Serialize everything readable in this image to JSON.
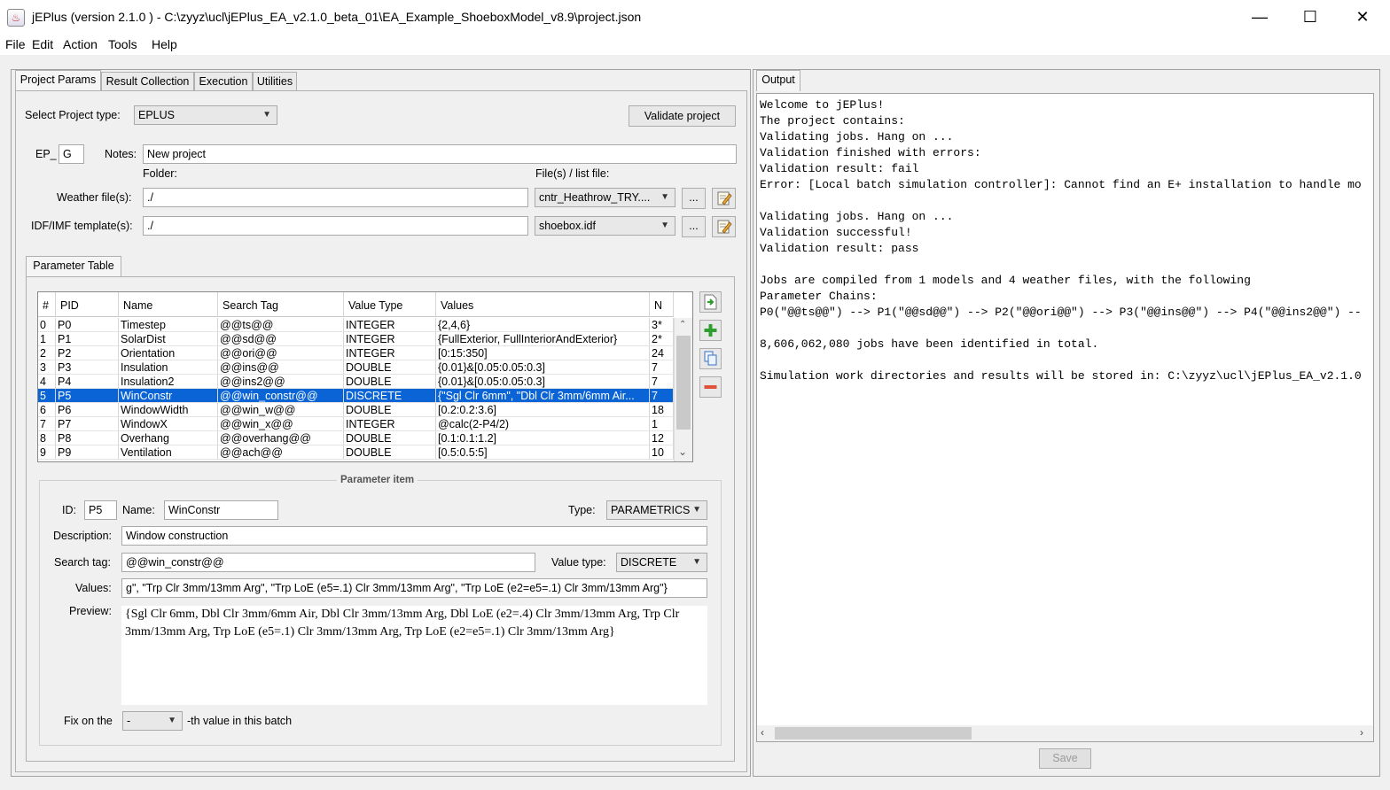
{
  "window": {
    "title": "jEPlus (version 2.1.0 )  - C:\\zyyz\\ucl\\jEPlus_EA_v2.1.0_beta_01\\EA_Example_ShoeboxModel_v8.9\\project.json",
    "minimize": "—",
    "maximize": "☐",
    "close": "✕"
  },
  "menu": [
    "File",
    "Edit",
    "Action",
    "Tools",
    "Help"
  ],
  "left_tabs": [
    "Project Params",
    "Result Collection",
    "Execution",
    "Utilities"
  ],
  "project": {
    "type_label": "Select Project type:",
    "type_value": "EPLUS",
    "validate_label": "Validate project",
    "ep_label": "EP_",
    "ep_value": "G",
    "notes_label": "Notes:",
    "notes_value": "New project",
    "folder_label": "Folder:",
    "files_label": "File(s) / list file:",
    "weather_label": "Weather file(s):",
    "weather_folder": "./",
    "weather_file": "cntr_Heathrow_TRY....",
    "idf_label": "IDF/IMF template(s):",
    "idf_folder": "./",
    "idf_file": "shoebox.idf",
    "browse": "..."
  },
  "param_table": {
    "tab_label": "Parameter Table",
    "columns": [
      "#",
      "PID",
      "Name",
      "Search Tag",
      "Value Type",
      "Values",
      "N"
    ],
    "rows": [
      [
        "0",
        "P0",
        "Timestep",
        "@@ts@@",
        "INTEGER",
        "{2,4,6}",
        "3*"
      ],
      [
        "1",
        "P1",
        "SolarDist",
        "@@sd@@",
        "INTEGER",
        "{FullExterior, FullInteriorAndExterior}",
        "2*"
      ],
      [
        "2",
        "P2",
        "Orientation",
        "@@ori@@",
        "INTEGER",
        "[0:15:350]",
        "24"
      ],
      [
        "3",
        "P3",
        "Insulation",
        "@@ins@@",
        "DOUBLE",
        "{0.01}&[0.05:0.05:0.3]",
        "7"
      ],
      [
        "4",
        "P4",
        "Insulation2",
        "@@ins2@@",
        "DOUBLE",
        "{0.01}&[0.05:0.05:0.3]",
        "7"
      ],
      [
        "5",
        "P5",
        "WinConstr",
        "@@win_constr@@",
        "DISCRETE",
        "{\"Sgl Clr 6mm\", \"Dbl Clr 3mm/6mm Air...",
        "7"
      ],
      [
        "6",
        "P6",
        "WindowWidth",
        "@@win_w@@",
        "DOUBLE",
        "[0.2:0.2:3.6]",
        "18"
      ],
      [
        "7",
        "P7",
        "WindowX",
        "@@win_x@@",
        "INTEGER",
        "@calc(2-P4/2)",
        "1"
      ],
      [
        "8",
        "P8",
        "Overhang",
        "@@overhang@@",
        "DOUBLE",
        "[0.1:0.1:1.2]",
        "12"
      ],
      [
        "9",
        "P9",
        "Ventilation",
        "@@ach@@",
        "DOUBLE",
        "[0.5:0.5:5]",
        "10"
      ]
    ]
  },
  "param_item": {
    "group_title": "Parameter item",
    "id_label": "ID:",
    "id_value": "P5",
    "name_label": "Name:",
    "name_value": "WinConstr",
    "type_label": "Type:",
    "type_value": "PARAMETRICS",
    "desc_label": "Description:",
    "desc_value": "Window construction",
    "tag_label": "Search tag:",
    "tag_value": "@@win_constr@@",
    "vtype_label": "Value type:",
    "vtype_value": "DISCRETE",
    "values_label": "Values:",
    "values_value": "g\", \"Trp Clr 3mm/13mm Arg\", \"Trp LoE (e5=.1) Clr 3mm/13mm Arg\", \"Trp LoE (e2=e5=.1) Clr 3mm/13mm Arg\"}",
    "preview_label": "Preview:",
    "preview_value": "{Sgl Clr 6mm, Dbl Clr 3mm/6mm Air, Dbl Clr 3mm/13mm Arg, Dbl LoE (e2=.4) Clr 3mm/13mm Arg, Trp Clr 3mm/13mm Arg, Trp LoE (e5=.1) Clr 3mm/13mm Arg, Trp LoE (e2=e5=.1) Clr 3mm/13mm Arg}",
    "fix_label": "Fix on the",
    "fix_value": "-",
    "fix_suffix": "-th value in this batch"
  },
  "output": {
    "tab_label": "Output",
    "lines": [
      "Welcome to jEPlus!",
      "The project contains:",
      "Validating jobs. Hang on ...",
      "Validation finished with errors:",
      "Validation result: fail",
      "Error: [Local batch simulation controller]: Cannot find an E+ installation to handle mo",
      "",
      "Validating jobs. Hang on ...",
      "Validation successful!",
      "Validation result: pass",
      "",
      "Jobs are compiled from 1 models and 4 weather files, with the following",
      "Parameter Chains:",
      "P0(\"@@ts@@\") --> P1(\"@@sd@@\") --> P2(\"@@ori@@\") --> P3(\"@@ins@@\") --> P4(\"@@ins2@@\") --",
      "",
      "8,606,062,080 jobs have been identified in total.",
      "",
      "Simulation work directories and results will be stored in: C:\\zyyz\\ucl\\jEPlus_EA_v2.1.0"
    ],
    "save_label": "Save"
  },
  "colors": {
    "selection": "#0a64d6",
    "background": "#f0f0f0"
  }
}
